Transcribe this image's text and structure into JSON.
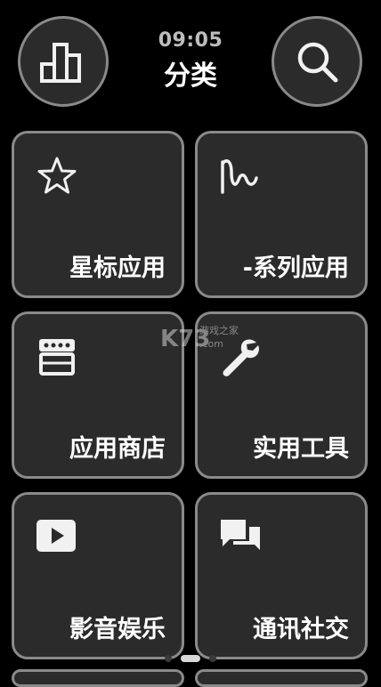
{
  "header": {
    "time": "09:05",
    "title": "分类",
    "left_button_icon": "bar-chart-icon",
    "right_button_icon": "search-icon"
  },
  "tiles": [
    {
      "label": "星标应用",
      "icon": "star-icon"
    },
    {
      "label": "-系列应用",
      "icon": "signature-icon"
    },
    {
      "label": "应用商店",
      "icon": "store-icon"
    },
    {
      "label": "实用工具",
      "icon": "wrench-icon"
    },
    {
      "label": "影音娱乐",
      "icon": "play-icon"
    },
    {
      "label": "通讯社交",
      "icon": "chat-icon"
    }
  ],
  "watermark": {
    "brand": "K73",
    "site": "游戏之家",
    "domain": ".com"
  },
  "pager": {
    "count": 3,
    "active_index": 1
  },
  "colors": {
    "background": "#000000",
    "tile_fill": "#2b2b2b",
    "tile_border": "#8a8a8a",
    "text": "#ffffff"
  }
}
